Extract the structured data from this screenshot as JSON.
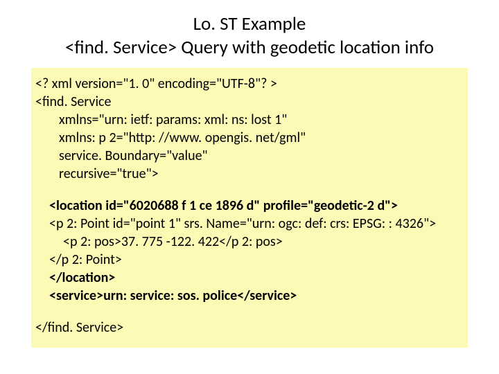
{
  "title_line1": "Lo. ST Example",
  "title_line2": "<find. Service> Query with geodetic location info",
  "code": {
    "l1": "<? xml version=\"1. 0\" encoding=\"UTF-8\"? >",
    "l2": "<find. Service",
    "l3": "xmlns=\"urn: ietf: params: xml: ns: lost 1\"",
    "l4": "xmlns: p 2=\"http: //www. opengis. net/gml\"",
    "l5": "service. Boundary=\"value\"",
    "l6": "recursive=\"true\">",
    "l7": "<location id=\"6020688 f 1 ce 1896 d\" profile=\"geodetic-2 d\">",
    "l8": "<p 2: Point id=\"point 1\" srs. Name=\"urn: ogc: def: crs: EPSG: : 4326\">",
    "l9": "<p 2: pos>37. 775 -122. 422</p 2: pos>",
    "l10": "</p 2: Point>",
    "l11": "</location>",
    "l12": "<service>urn: service: sos. police</service>",
    "l13": "</find. Service>"
  }
}
